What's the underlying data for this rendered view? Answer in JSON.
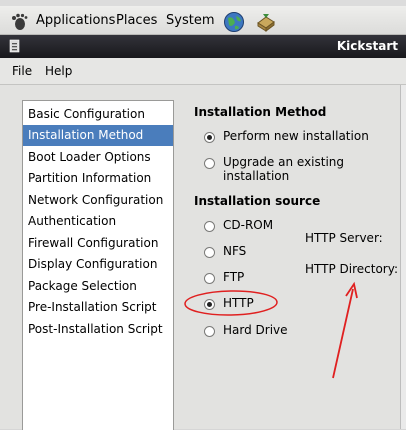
{
  "panel": {
    "applications": "Applications",
    "places": "Places",
    "system": "System",
    "icons": [
      "gnome-foot-icon",
      "network-globe-icon",
      "package-updater-icon"
    ]
  },
  "window": {
    "title": "Kickstart"
  },
  "menubar": {
    "file": "File",
    "help": "Help"
  },
  "sidebar": {
    "items": [
      {
        "label": "Basic Configuration"
      },
      {
        "label": "Installation Method"
      },
      {
        "label": "Boot Loader Options"
      },
      {
        "label": "Partition Information"
      },
      {
        "label": "Network Configuration"
      },
      {
        "label": "Authentication"
      },
      {
        "label": "Firewall Configuration"
      },
      {
        "label": "Display Configuration"
      },
      {
        "label": "Package Selection"
      },
      {
        "label": "Pre-Installation Script"
      },
      {
        "label": "Post-Installation Script"
      }
    ],
    "selected": "Installation Method"
  },
  "install_method": {
    "heading": "Installation Method",
    "options": [
      {
        "label": "Perform new installation",
        "selected": true
      },
      {
        "label": "Upgrade an existing installation",
        "selected": false
      }
    ]
  },
  "install_source": {
    "heading": "Installation source",
    "options": [
      {
        "label": "CD-ROM",
        "selected": false
      },
      {
        "label": "NFS",
        "selected": false
      },
      {
        "label": "FTP",
        "selected": false
      },
      {
        "label": "HTTP",
        "selected": true
      },
      {
        "label": "Hard Drive",
        "selected": false
      }
    ],
    "http_server_label": "HTTP Server:",
    "http_directory_label": "HTTP Directory:"
  },
  "annotation": {
    "color": "#e02020"
  }
}
